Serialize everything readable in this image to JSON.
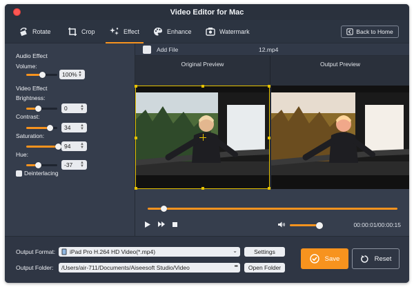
{
  "window": {
    "title": "Video Editor for Mac"
  },
  "toolbar": {
    "tabs": [
      {
        "label": "Rotate",
        "icon": "rotate-icon"
      },
      {
        "label": "Crop",
        "icon": "crop-icon"
      },
      {
        "label": "Effect",
        "icon": "effect-icon",
        "active": true
      },
      {
        "label": "Enhance",
        "icon": "palette-icon"
      },
      {
        "label": "Watermark",
        "icon": "watermark-icon"
      }
    ],
    "back_label": "Back to Home"
  },
  "audio": {
    "section": "Audio Effect",
    "volume_label": "Volume:",
    "volume_value": "100%",
    "volume_level": 0.5
  },
  "video": {
    "section": "Video Effect",
    "brightness_label": "Brightness:",
    "brightness_value": "0",
    "contrast_label": "Contrast:",
    "contrast_value": "34",
    "saturation_label": "Saturation:",
    "saturation_value": "94",
    "hue_label": "Hue:",
    "hue_value": "-37",
    "deinterlacing_label": "Deinterlacing"
  },
  "preview": {
    "add_file": "Add File",
    "filename": "12.mp4",
    "original_label": "Original Preview",
    "output_label": "Output Preview"
  },
  "player": {
    "time": "00:00:01/00:00:15",
    "progress": 0.07
  },
  "output": {
    "format_label": "Output Format:",
    "format_value": "iPad Pro H.264 HD Video(*.mp4)",
    "settings_label": "Settings",
    "folder_label": "Output Folder:",
    "folder_value": "/Users/air-711/Documents/Aiseesoft Studio/Video",
    "folder_more": "•••",
    "open_folder_label": "Open Folder"
  },
  "actions": {
    "save_label": "Save",
    "reset_label": "Reset"
  },
  "colors": {
    "accent": "#f7931e",
    "background": "#343c4b",
    "crop_border": "#e6c200"
  }
}
